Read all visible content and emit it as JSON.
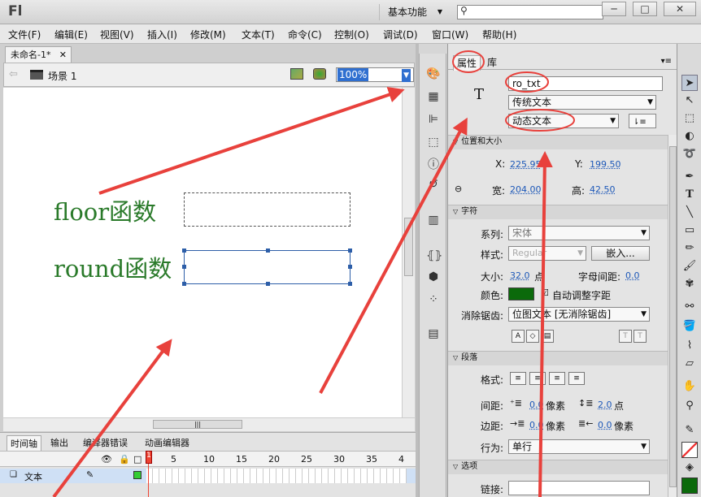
{
  "app": {
    "logo": "Fl",
    "workspace": "基本功能",
    "search_placeholder": "",
    "window_buttons": [
      "─",
      "□",
      "✕"
    ]
  },
  "menu": [
    "文件(F)",
    "编辑(E)",
    "视图(V)",
    "插入(I)",
    "修改(M)",
    "文本(T)",
    "命令(C)",
    "控制(O)",
    "调试(D)",
    "窗口(W)",
    "帮助(H)"
  ],
  "document": {
    "tab_title": "未命名-1*",
    "scene_label": "场景 1",
    "zoom": "100%",
    "stage": {
      "floor_label": "floor函数",
      "round_label": "round函数",
      "label_color": "#2a7a2a"
    }
  },
  "timeline": {
    "tabs": [
      "时间轴",
      "输出",
      "编译器错误",
      "动画编辑器"
    ],
    "frame_numbers": [
      "1",
      "5",
      "10",
      "15",
      "20",
      "25",
      "30",
      "35",
      "4"
    ],
    "layer_name": "文本"
  },
  "properties": {
    "tabs": [
      "属性",
      "库"
    ],
    "instance_name": "ro_txt",
    "text_engine": "传统文本",
    "text_type": "动态文本",
    "position_section": "位置和大小",
    "x_label": "X:",
    "x_value": "225.95",
    "y_label": "Y:",
    "y_value": "199.50",
    "width_label": "宽:",
    "width_value": "204.00",
    "height_label": "高:",
    "height_value": "42.50",
    "char_section": "字符",
    "family_label": "系列:",
    "family_value": "宋体",
    "style_label": "样式:",
    "style_value": "Regular",
    "embed_button": "嵌入...",
    "size_label": "大小:",
    "size_value": "32.0",
    "size_unit": "点",
    "letter_spacing_label": "字母间距:",
    "letter_spacing_value": "0.0",
    "color_label": "颜色:",
    "color_value": "#0b6a0b",
    "auto_kern_label": "自动调整字距",
    "antialias_label": "消除锯齿:",
    "antialias_value": "位图文本 [无消除锯齿]",
    "para_section": "段落",
    "format_label": "格式:",
    "spacing_label": "间距:",
    "spacing_value1": "0.0",
    "spacing_unit1": "像素",
    "spacing_value2": "2.0",
    "spacing_unit2": "点",
    "margin_label": "边距:",
    "margin_value1": "0.0",
    "margin_unit1": "像素",
    "margin_value2": "0.0",
    "margin_unit2": "像素",
    "behavior_label": "行为:",
    "behavior_value": "单行",
    "options_section": "选项",
    "link_label": "链接:"
  },
  "annotation": {
    "arrow_color": "#e8413c"
  }
}
